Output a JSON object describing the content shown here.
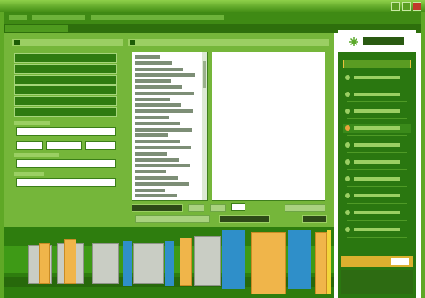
{
  "window": {
    "title": ""
  },
  "menubar": {
    "items": [
      "",
      "",
      ""
    ]
  },
  "left_panel": {
    "title": "",
    "buttons": [
      "",
      "",
      "",
      "",
      "",
      ""
    ],
    "fields": [
      {
        "label": "",
        "value": ""
      },
      {
        "label": "",
        "value": ""
      },
      {
        "label": "",
        "value": ""
      }
    ]
  },
  "list_panel": {
    "title": "",
    "items": [
      "",
      "",
      "",
      "",
      "",
      "",
      "",
      "",
      "",
      "",
      "",
      "",
      "",
      "",
      "",
      "",
      "",
      "",
      "",
      "",
      "",
      "",
      "",
      ""
    ]
  },
  "bottom_buttons": [
    "",
    "",
    "",
    ""
  ],
  "sidebar": {
    "header": "",
    "items": [
      "",
      "",
      "",
      "",
      "",
      "",
      "",
      "",
      "",
      ""
    ],
    "active_index": 3
  },
  "colors": {
    "frame": "#5fa826",
    "dark_green": "#2a7710",
    "panel_green": "#75b63a",
    "accent_orange": "#e9a33b",
    "block_blue": "#2f8fc9",
    "block_orange": "#f0b54a"
  }
}
